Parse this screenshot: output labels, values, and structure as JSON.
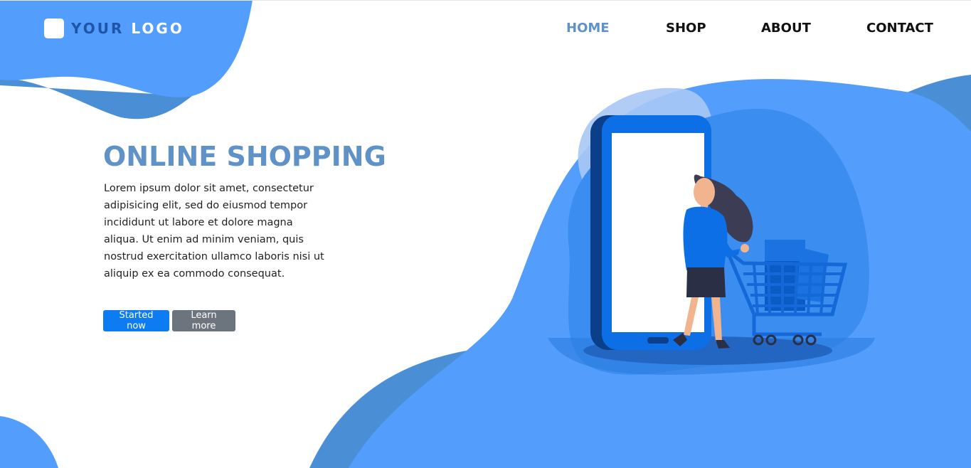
{
  "brand": {
    "logo_word1": "YOUR",
    "logo_word2": "LOGO"
  },
  "nav": {
    "items": [
      {
        "label": "HOME",
        "active": true
      },
      {
        "label": "SHOP",
        "active": false
      },
      {
        "label": "ABOUT",
        "active": false
      },
      {
        "label": "CONTACT",
        "active": false
      }
    ]
  },
  "hero": {
    "title": "ONLINE SHOPPING",
    "text": "Lorem ipsum dolor sit amet, consectetur adipisicing elit, sed do eiusmod tempor incididunt ut labore et dolore magna aliqua. Ut enim ad minim veniam, quis nostrud exercitation ullamco laboris nisi ut aliquip ex ea commodo consequat.",
    "primary_button": "Started now",
    "secondary_button": "Learn more"
  },
  "colors": {
    "accent_blue": "#539efc",
    "dark_blue": "#4a8fd6",
    "title_blue": "#5f92c8",
    "primary_button": "#0d7bf1",
    "secondary_button": "#6c757d"
  },
  "illustration": {
    "icon": "shopping-woman-phone-cart-illustration"
  }
}
